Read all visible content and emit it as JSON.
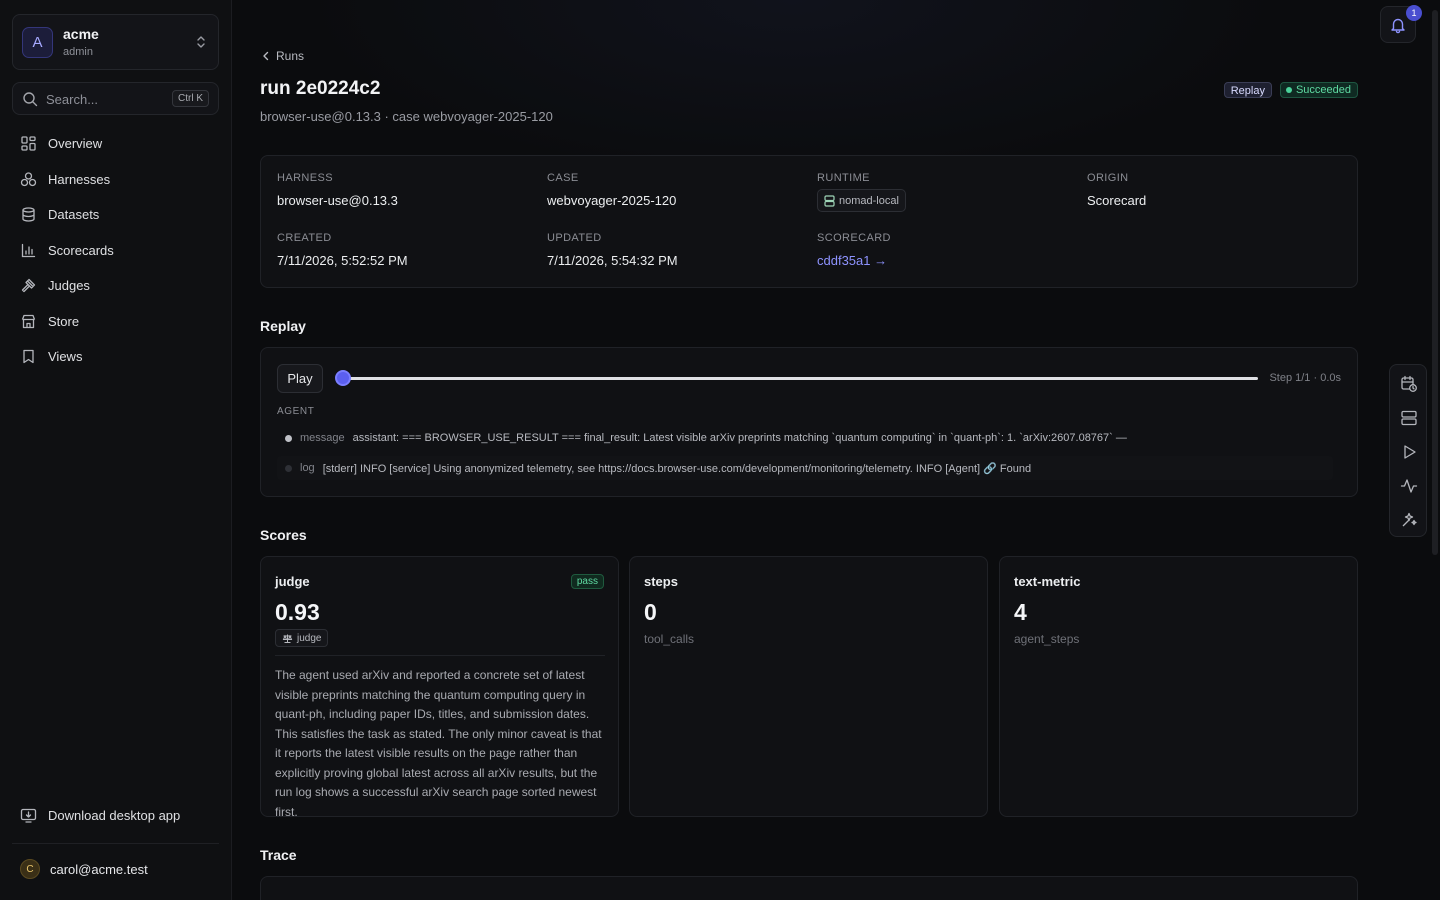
{
  "org": {
    "initial": "A",
    "name": "acme",
    "role": "admin"
  },
  "search": {
    "placeholder": "Search...",
    "shortcut": "Ctrl K"
  },
  "nav": [
    {
      "label": "Overview",
      "icon": "grid-icon"
    },
    {
      "label": "Harnesses",
      "icon": "cubes-icon"
    },
    {
      "label": "Datasets",
      "icon": "database-icon"
    },
    {
      "label": "Scorecards",
      "icon": "bar-chart-icon"
    },
    {
      "label": "Judges",
      "icon": "gavel-icon"
    },
    {
      "label": "Store",
      "icon": "store-icon"
    },
    {
      "label": "Views",
      "icon": "bookmark-icon"
    }
  ],
  "download_label": "Download desktop app",
  "user": {
    "initial": "C",
    "email": "carol@acme.test"
  },
  "notifications": {
    "count": "1"
  },
  "breadcrumb": "Runs",
  "run": {
    "title": "run 2e0224c2",
    "subtitle": "browser-use@0.13.3 · case webvoyager-2025-120",
    "badge_replay": "Replay",
    "status": "Succeeded"
  },
  "meta": {
    "harness_label": "HARNESS",
    "harness": "browser-use@0.13.3",
    "case_label": "CASE",
    "case": "webvoyager-2025-120",
    "runtime_label": "RUNTIME",
    "runtime": "nomad-local",
    "origin_label": "ORIGIN",
    "origin": "Scorecard",
    "created_label": "CREATED",
    "created": "7/11/2026, 5:52:52 PM",
    "updated_label": "UPDATED",
    "updated": "7/11/2026, 5:54:32 PM",
    "scorecard_label": "SCORECARD",
    "scorecard": "cddf35a1 →"
  },
  "replay": {
    "section_title": "Replay",
    "play_label": "Play",
    "progress": 0,
    "step_text": "Step 1/1 · 0.0s",
    "agent_label": "AGENT",
    "events": [
      {
        "kind": "message",
        "text": "assistant: === BROWSER_USE_RESULT === final_result: Latest visible arXiv preprints matching `quantum computing` in `quant-ph`: 1. `arXiv:2607.08767` —"
      },
      {
        "kind": "log",
        "text": "[stderr] INFO [service] Using anonymized telemetry, see https://docs.browser-use.com/development/monitoring/telemetry. INFO [Agent] 🔗 Found"
      }
    ]
  },
  "scores": {
    "section_title": "Scores",
    "items": [
      {
        "name": "judge",
        "value": "0.93",
        "badge": "pass",
        "chip": "judge",
        "reasoning": "The agent used arXiv and reported a concrete set of latest visible preprints matching the quantum computing query in quant-ph, including paper IDs, titles, and submission dates. This satisfies the task as stated. The only minor caveat is that it reports the latest visible results on the page rather than explicitly proving global latest across all arXiv results, but the run log shows a successful arXiv search page sorted newest first."
      },
      {
        "name": "steps",
        "value": "0",
        "sub": "tool_calls"
      },
      {
        "name": "text-metric",
        "value": "4",
        "sub": "agent_steps"
      }
    ]
  },
  "trace": {
    "section_title": "Trace"
  },
  "colors": {
    "accent": "#5b5ff0",
    "success": "#4ad39a",
    "link": "#8e93ff"
  }
}
